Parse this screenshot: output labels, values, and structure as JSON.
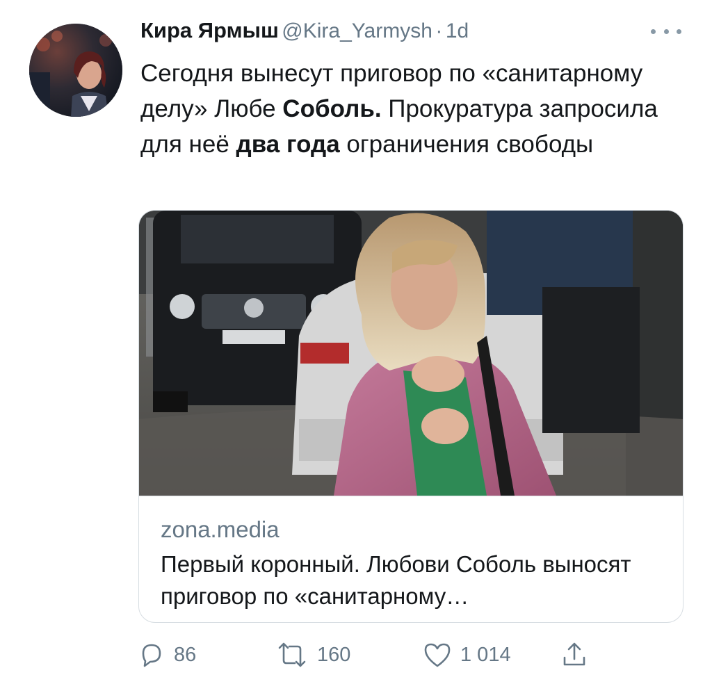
{
  "tweet": {
    "author_name": "Кира Ярмыш",
    "author_handle": "@Kira_Yarmysh",
    "separator": "·",
    "time": "1d",
    "text_segments": [
      {
        "text": "Сегодня вынесут приговор по «санитарному делу» Любе ",
        "bold": false
      },
      {
        "text": "Соболь.",
        "bold": true
      },
      {
        "text": " Прокуратура запросила для неё ",
        "bold": false
      },
      {
        "text": "два года",
        "bold": true
      },
      {
        "text": " ограничения свободы",
        "bold": false
      }
    ]
  },
  "link_card": {
    "domain": "zona.media",
    "title": "Первый коронный. Любови Соболь выносят приговор по «санитарному…"
  },
  "actions": {
    "replies": "86",
    "retweets": "160",
    "likes": "1 014"
  },
  "icons": {
    "more": "more-icon",
    "reply": "reply-icon",
    "retweet": "retweet-icon",
    "like": "heart-icon",
    "share": "share-icon"
  },
  "colors": {
    "text": "#14171a",
    "secondary": "#657786",
    "border": "#d7dde2"
  }
}
